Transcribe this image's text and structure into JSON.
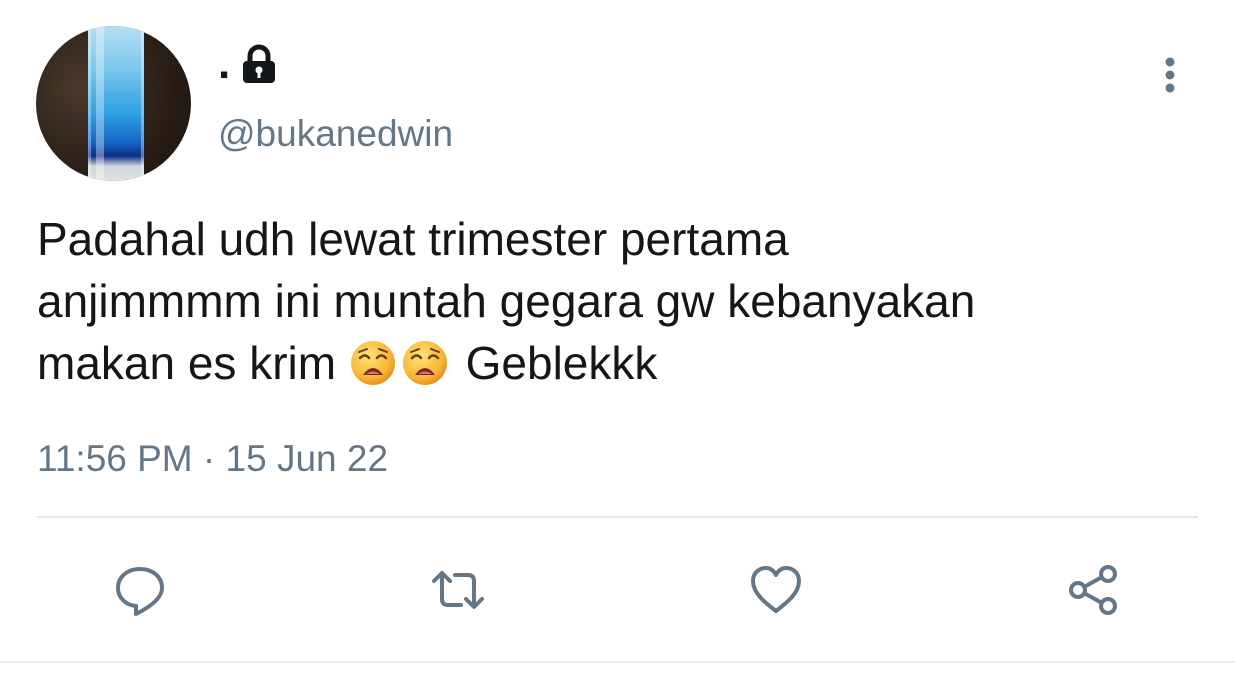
{
  "tweet": {
    "display_name": ".",
    "handle": "@bukanedwin",
    "text_lines": [
      "Padahal udh lewat trimester pertama",
      "anjimmmm ini muntah gegara gw kebanyakan",
      "makan es krim"
    ],
    "text_suffix": "Geblekkk",
    "emojis": [
      "weary-face-icon",
      "weary-face-icon"
    ],
    "timestamp": "11:56 PM · 15 Jun 22"
  },
  "icons": {
    "lock": "lock-icon",
    "more": "more-vertical-icon",
    "reply": "reply-icon",
    "retweet": "retweet-icon",
    "like": "heart-icon",
    "share": "share-icon"
  },
  "colors": {
    "text": "#14171a",
    "secondary": "#657786",
    "divider": "#e1e8ed"
  }
}
